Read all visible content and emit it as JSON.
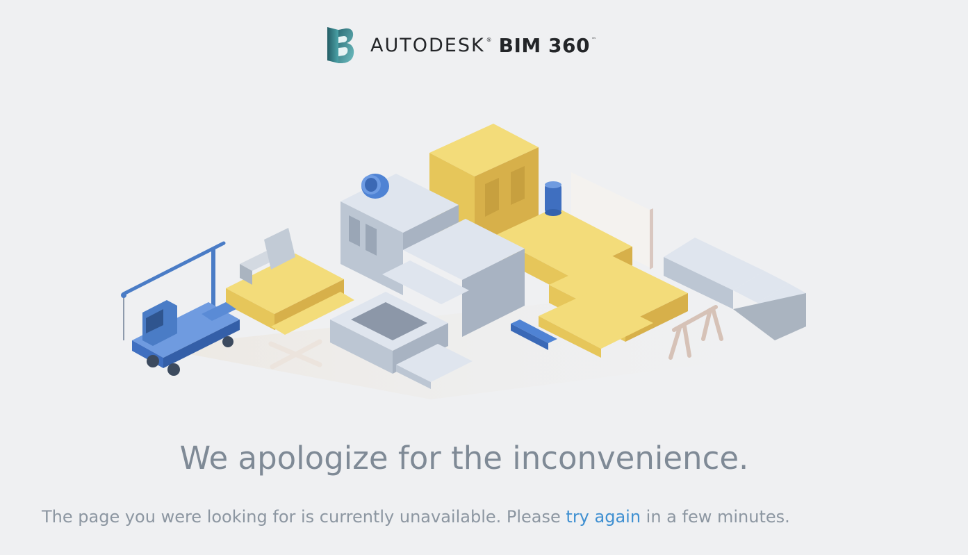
{
  "header": {
    "brand": "AUTODESK",
    "registered_mark": "®",
    "product": "BIM 360",
    "trademark": "™",
    "logo_icon": "bim-360-b-logo"
  },
  "illustration": {
    "icon": "construction-site-illustration"
  },
  "error": {
    "headline": "We apologize for the inconvenience.",
    "message_prefix": "The page you were looking for is currently unavailable. Please ",
    "link_text": "try again",
    "message_suffix": " in a few minutes."
  },
  "colors": {
    "background": "#eff0f2",
    "headline_text": "#7f8a96",
    "body_text": "#8c96a1",
    "link": "#3e8fd1",
    "logo_teal": "#3a8e95",
    "yellow_block": "#e8c95a",
    "grey_block": "#c2cbd8",
    "blue_truck": "#4a7cc6"
  }
}
